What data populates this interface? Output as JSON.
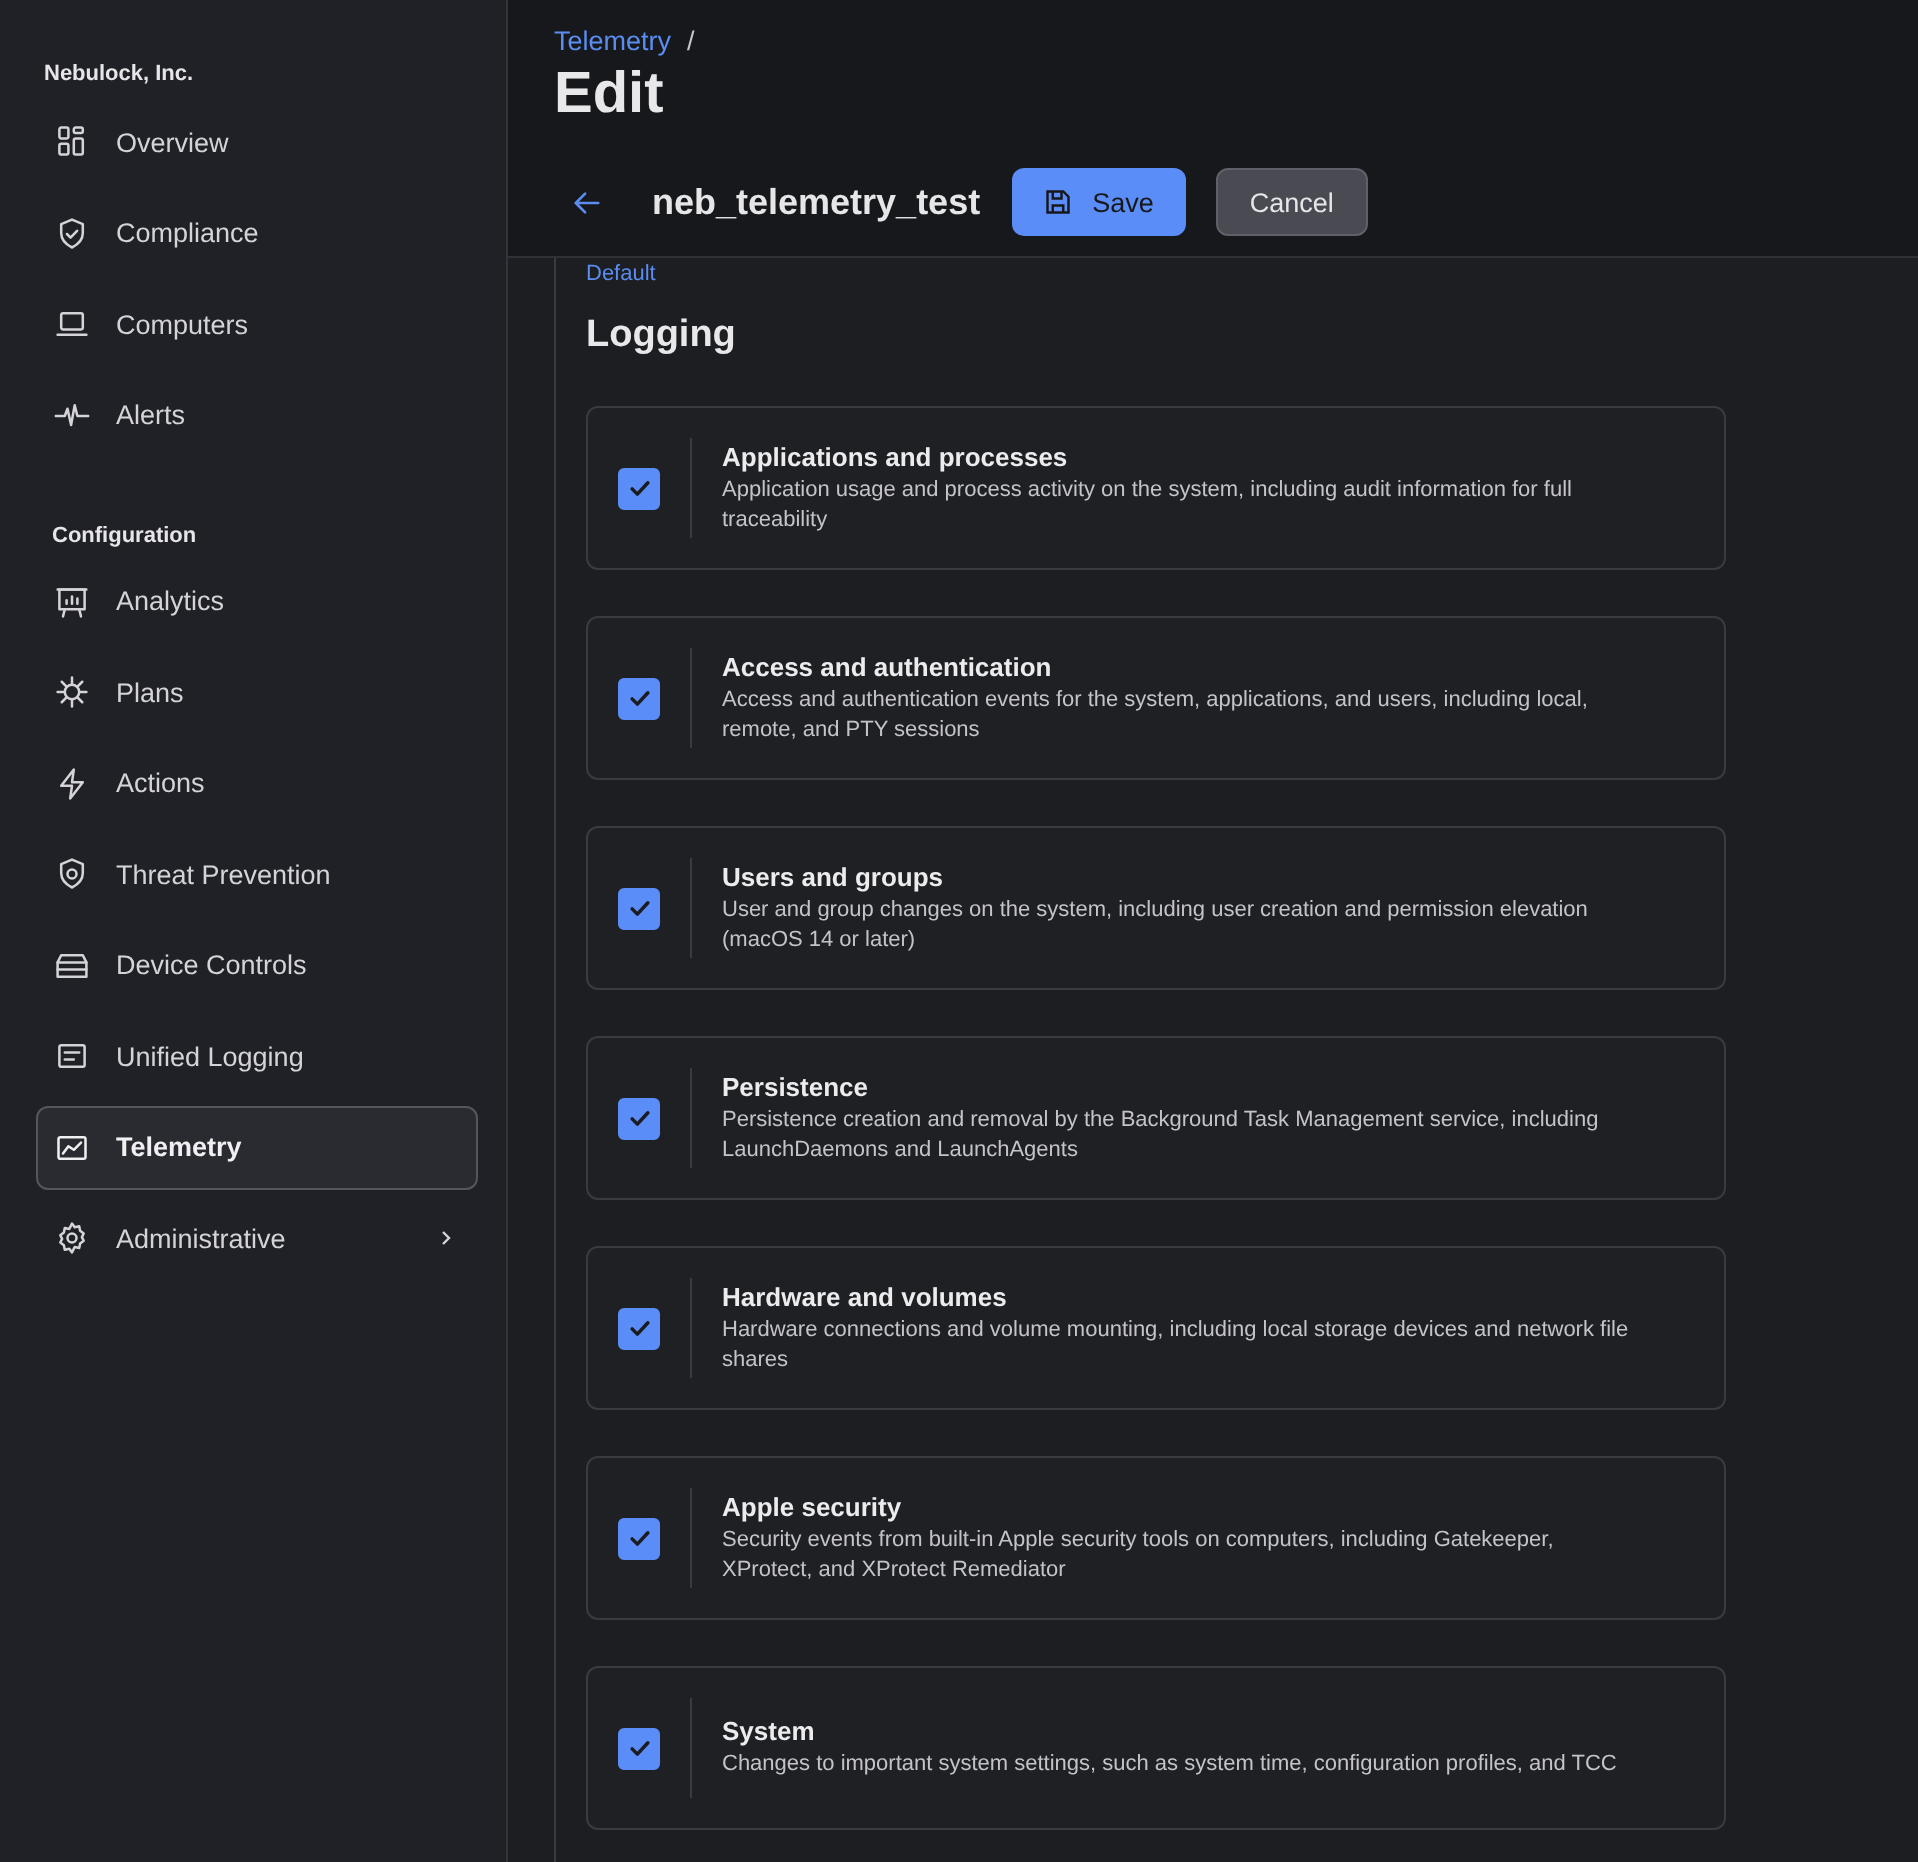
{
  "sidebar": {
    "org": "Nebulock, Inc.",
    "sections": [
      {
        "items": [
          {
            "label": "Overview",
            "selected": false
          },
          {
            "label": "Compliance",
            "selected": false
          },
          {
            "label": "Computers",
            "selected": false
          },
          {
            "label": "Alerts",
            "selected": false
          }
        ]
      },
      {
        "title": "Configuration",
        "items": [
          {
            "label": "Analytics",
            "selected": false
          },
          {
            "label": "Plans",
            "selected": false
          },
          {
            "label": "Actions",
            "selected": false
          },
          {
            "label": "Threat Prevention",
            "selected": false
          },
          {
            "label": "Device Controls",
            "selected": false
          },
          {
            "label": "Unified Logging",
            "selected": false
          },
          {
            "label": "Telemetry",
            "selected": true
          },
          {
            "label": "Administrative",
            "selected": false,
            "expandable": true
          }
        ]
      }
    ]
  },
  "breadcrumb": {
    "link": "Telemetry",
    "separator": "/"
  },
  "page_title": "Edit",
  "record": {
    "name": "neb_telemetry_test",
    "save": "Save",
    "cancel": "Cancel"
  },
  "above_text": "Default",
  "section_title": "Logging",
  "options": [
    {
      "title": "Applications and processes",
      "description": "Application usage and process activity on the system, including audit information for full traceability",
      "checked": true
    },
    {
      "title": "Access and authentication",
      "description": "Access and authentication events for the system, applications, and users, including local, remote, and PTY sessions",
      "checked": true
    },
    {
      "title": "Users and groups",
      "description": "User and group changes on the system, including user creation and permission elevation (macOS 14 or later)",
      "checked": true
    },
    {
      "title": "Persistence",
      "description": "Persistence creation and removal by the Background Task Management service, including LaunchDaemons and LaunchAgents",
      "checked": true
    },
    {
      "title": "Hardware and volumes",
      "description": "Hardware connections and volume mounting, including local storage devices and network file shares",
      "checked": true
    },
    {
      "title": "Apple security",
      "description": "Security events from built-in Apple security tools on computers, including Gatekeeper, XProtect, and XProtect Remediator",
      "checked": true
    },
    {
      "title": "System",
      "description": "Changes to important system settings, such as system time, configuration profiles, and TCC",
      "checked": true
    }
  ]
}
